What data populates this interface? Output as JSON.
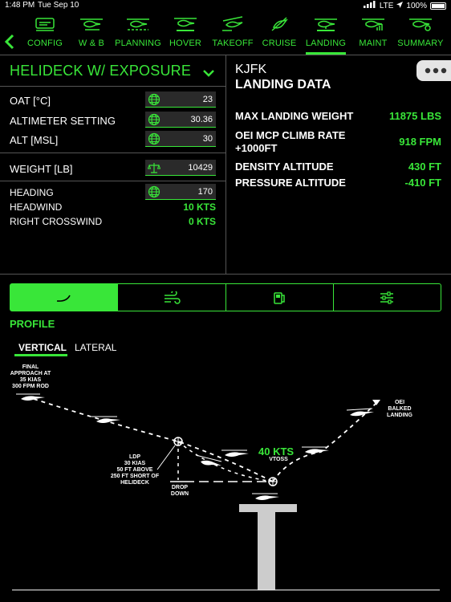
{
  "status": {
    "time": "1:48 PM",
    "date": "Tue Sep 10",
    "network": "LTE",
    "battery": "100%",
    "battery_level": 1.0
  },
  "tabs": [
    {
      "label": "CONFIG",
      "active": false
    },
    {
      "label": "W & B",
      "active": false
    },
    {
      "label": "PLANNING",
      "active": false
    },
    {
      "label": "HOVER",
      "active": false
    },
    {
      "label": "TAKEOFF",
      "active": false
    },
    {
      "label": "CRUISE",
      "active": false
    },
    {
      "label": "LANDING",
      "active": true
    },
    {
      "label": "MAINT",
      "active": false
    },
    {
      "label": "SUMMARY",
      "active": false
    }
  ],
  "colors": {
    "accent": "#39e639",
    "background": "#000000",
    "field": "#2a2a2a",
    "divider": "#555555"
  },
  "config": {
    "title": "HELIDECK W/ EXPOSURE",
    "oat": {
      "label": "OAT [°C]",
      "value": "23"
    },
    "altimeter": {
      "label": "ALTIMETER SETTING",
      "value": "30.36"
    },
    "alt": {
      "label": "ALT [MSL]",
      "value": "30"
    },
    "weight": {
      "label": "WEIGHT [LB]",
      "value": "10429"
    },
    "heading": {
      "label": "HEADING",
      "value": "170"
    },
    "headwind": {
      "label": "HEADWIND",
      "value": "10 KTS"
    },
    "crosswind": {
      "label": "RIGHT CROSSWIND",
      "value": "0 KTS"
    }
  },
  "landing": {
    "airport": "KJFK",
    "title": "LANDING DATA",
    "max_weight": {
      "label": "MAX LANDING WEIGHT",
      "value": "11875 LBS"
    },
    "climb_rate": {
      "label_line1": "OEI MCP CLIMB RATE",
      "label_line2": "+1000FT",
      "value": "918 FPM"
    },
    "density_alt": {
      "label": "DENSITY ALTITUDE",
      "value": "430 FT"
    },
    "pressure_alt": {
      "label": "PRESSURE ALTITUDE",
      "value": "-410 FT"
    }
  },
  "profile": {
    "label": "PROFILE",
    "subtabs": [
      "VERTICAL",
      "LATERAL"
    ],
    "active_subtab": "VERTICAL",
    "segments": [
      "profile-icon",
      "wind-icon",
      "fuel-icon",
      "sliders-icon"
    ],
    "diagram": {
      "final_approach": [
        "FINAL",
        "APPROACH AT",
        "35 KIAS",
        "300 FPM ROD"
      ],
      "ldp": [
        "LDP",
        "30 KIAS",
        "50 FT ABOVE",
        "250 FT SHORT OF",
        "HELIDECK"
      ],
      "drop_down": [
        "DROP",
        "DOWN"
      ],
      "speed": "40 KTS",
      "vtoss": "VTOSS",
      "oei_balked": [
        "OEI",
        "BALKED",
        "LANDING"
      ]
    }
  }
}
